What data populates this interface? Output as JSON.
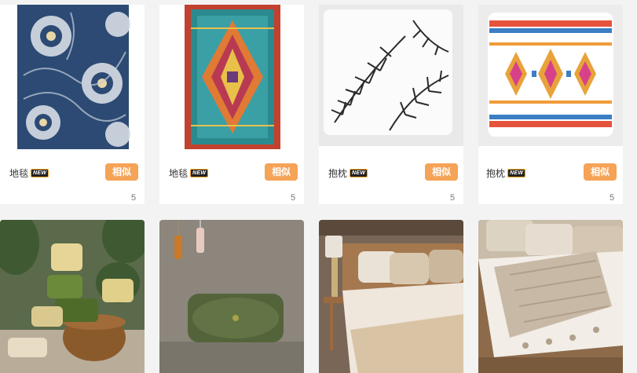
{
  "products": [
    {
      "name": "地毯",
      "badge": "NEW",
      "similar": "相似",
      "count": "5",
      "image": "blue-floral-rug"
    },
    {
      "name": "地毯",
      "badge": "NEW",
      "similar": "相似",
      "count": "5",
      "image": "colorful-medallion-rug"
    },
    {
      "name": "抱枕",
      "badge": "NEW",
      "similar": "相似",
      "count": "5",
      "image": "palm-leaf-pillow"
    },
    {
      "name": "抱枕",
      "badge": "NEW",
      "similar": "相似",
      "count": "5",
      "image": "geometric-pattern-pillow"
    }
  ],
  "photos": [
    {
      "image": "pillows-in-basket-with-plants"
    },
    {
      "image": "green-velvet-cushion-with-tassels"
    },
    {
      "image": "beige-bed-with-lamp"
    },
    {
      "image": "bed-with-knit-throw"
    }
  ],
  "colors": {
    "accent": "#f5a356",
    "background": "#f3f3f3"
  }
}
